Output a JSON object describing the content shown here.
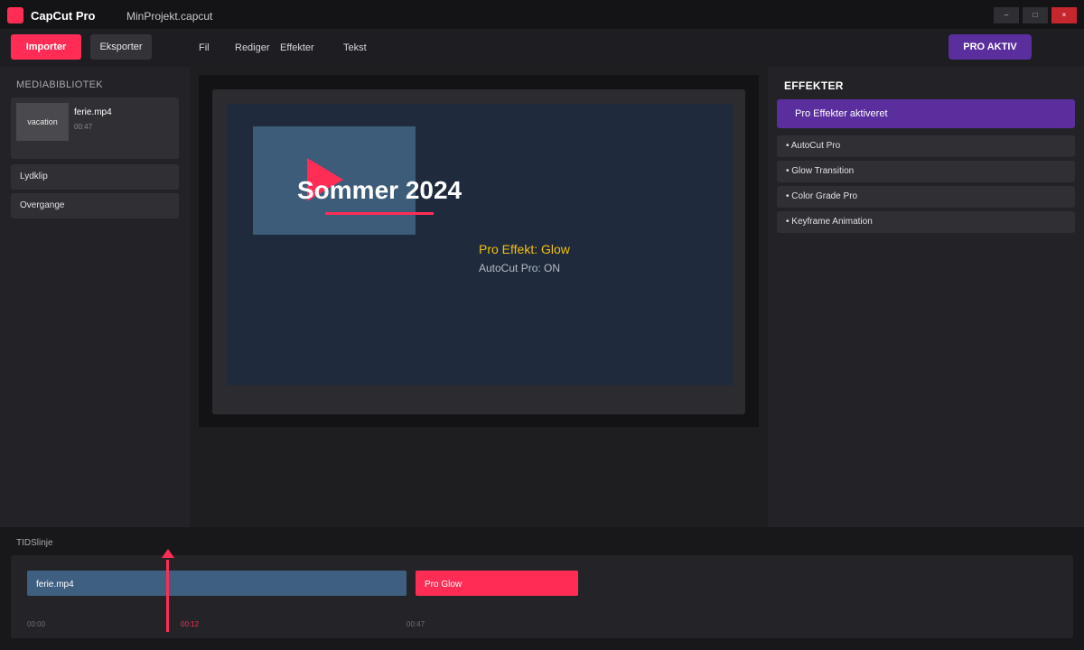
{
  "app": {
    "name": "CapCut Pro",
    "file": "MinProjekt.capcut",
    "window_controls": {
      "minimize": "–",
      "maximize": "□",
      "close": "×"
    }
  },
  "toolbar": {
    "import_label": "Importer",
    "export_label": "Eksporter",
    "menu": [
      "Fil",
      "Rediger",
      "Effekter",
      "Tekst"
    ],
    "pro_label": "PRO AKTIV"
  },
  "media_library": {
    "heading": "MEDIABIBLIOTEK",
    "items": [
      {
        "thumb_label": "vacation",
        "name": "ferie.mp4",
        "duration": "00:47"
      }
    ],
    "sections": [
      "Lydklip",
      "Overgange"
    ]
  },
  "preview": {
    "title": "Sommer 2024",
    "effect_label": "Pro Effekt: Glow",
    "autocut_label": "AutoCut Pro: ON"
  },
  "effects_panel": {
    "heading": "EFFEKTER",
    "banner": "Pro Effekter aktiveret",
    "items": [
      "• AutoCut Pro",
      "• Glow Transition",
      "• Color Grade Pro",
      "• Keyframe Animation"
    ]
  },
  "timeline": {
    "heading": "TIDSlinje",
    "clips": [
      {
        "name": "ferie.mp4",
        "kind": "video"
      },
      {
        "name": "Pro Glow",
        "kind": "effect"
      }
    ],
    "time_start": "00:00",
    "time_current": "00:12",
    "time_end": "00:47"
  },
  "colors": {
    "accent": "#ff2d55",
    "pro_purple": "#5b2e9e",
    "effect_yellow": "#f2c010",
    "video_clip": "#3e5f80"
  },
  "icons": {
    "logo": "app-logo-icon",
    "play": "play-icon",
    "playhead": "playhead-marker-icon"
  }
}
